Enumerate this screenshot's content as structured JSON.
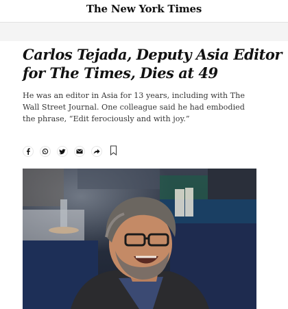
{
  "masthead": {
    "title": "The New York Times"
  },
  "article": {
    "headline": "Carlos Tejada, Deputy Asia Editor for The Times, Dies at 49",
    "summary": "He was an editor in Asia for 13 years, including with The Wall Street Journal. One colleague said he had embodied the phrase, “Edit ferociously and with joy.”"
  },
  "share_icons": [
    "facebook-icon",
    "whatsapp-icon",
    "twitter-icon",
    "email-icon",
    "share-arrow-icon",
    "bookmark-icon"
  ],
  "colors": {
    "text": "#121212",
    "summary": "#363636",
    "band": "#f4f4f4"
  }
}
